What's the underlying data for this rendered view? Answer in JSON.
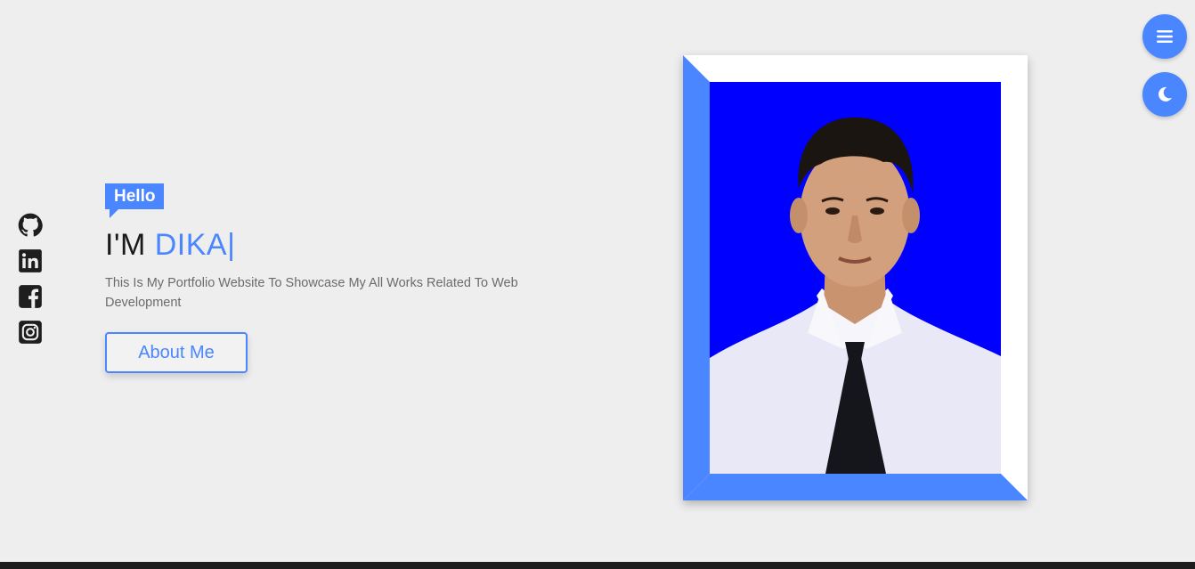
{
  "hero": {
    "badge": "Hello",
    "headline_prefix": "I'M ",
    "headline_name": "DIKA",
    "cursor": "|",
    "description": "This Is My Portfolio Website To Showcase My All Works Related To Web Development",
    "about_button": "About Me"
  },
  "socials": [
    {
      "icon": "github-icon"
    },
    {
      "icon": "linkedin-icon"
    },
    {
      "icon": "facebook-icon"
    },
    {
      "icon": "instagram-icon"
    }
  ],
  "controls": {
    "menu_icon": "hamburger-menu-icon",
    "theme_icon": "moon-icon"
  },
  "colors": {
    "accent": "#4a86ff",
    "background": "#eeeeee",
    "photo_background": "#0000ff",
    "text_dark": "#1a1a1a",
    "text_muted": "#6b6b6b"
  }
}
